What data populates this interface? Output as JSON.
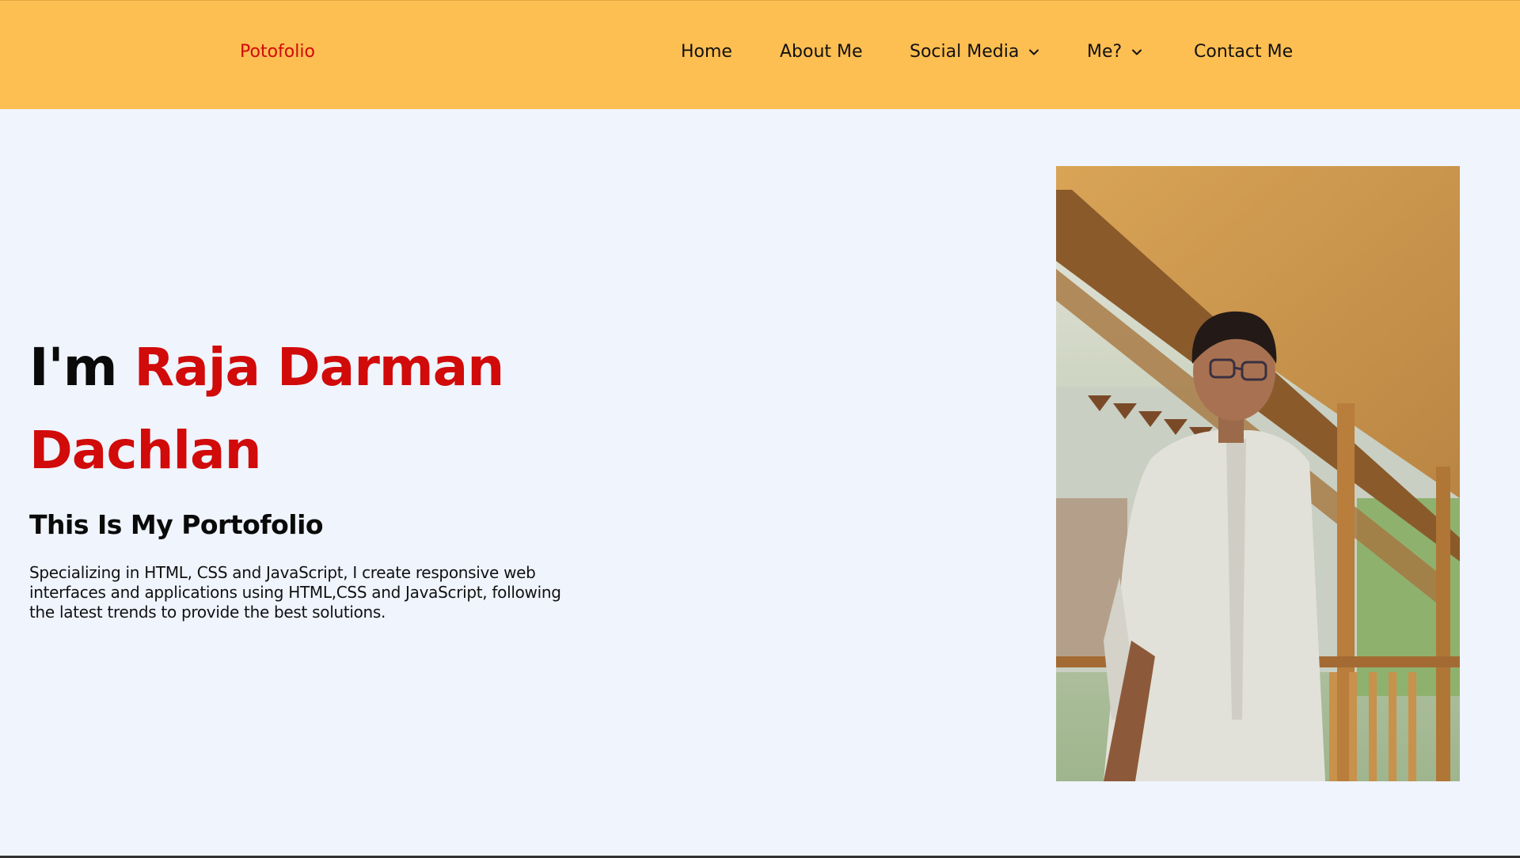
{
  "brand": {
    "label": "Potofolio"
  },
  "nav": {
    "home": "Home",
    "about": "About Me",
    "social": "Social Media",
    "me": "Me?",
    "contact": "Contact Me"
  },
  "hero": {
    "prefix": "I'm ",
    "name": "Raja Darman Dachlan",
    "subtitle": "This Is My Portofolio",
    "description": "Specializing in HTML, CSS and JavaScript, I create responsive web interfaces and applications using HTML,CSS and JavaScript, following the latest trends to provide the best solutions."
  },
  "colors": {
    "navbar": "#fdbe52",
    "accent": "#d10a0a",
    "background": "#f0f4fd",
    "text": "#0a0a0a"
  },
  "icons": {
    "dropdown": "chevron-down-icon"
  }
}
